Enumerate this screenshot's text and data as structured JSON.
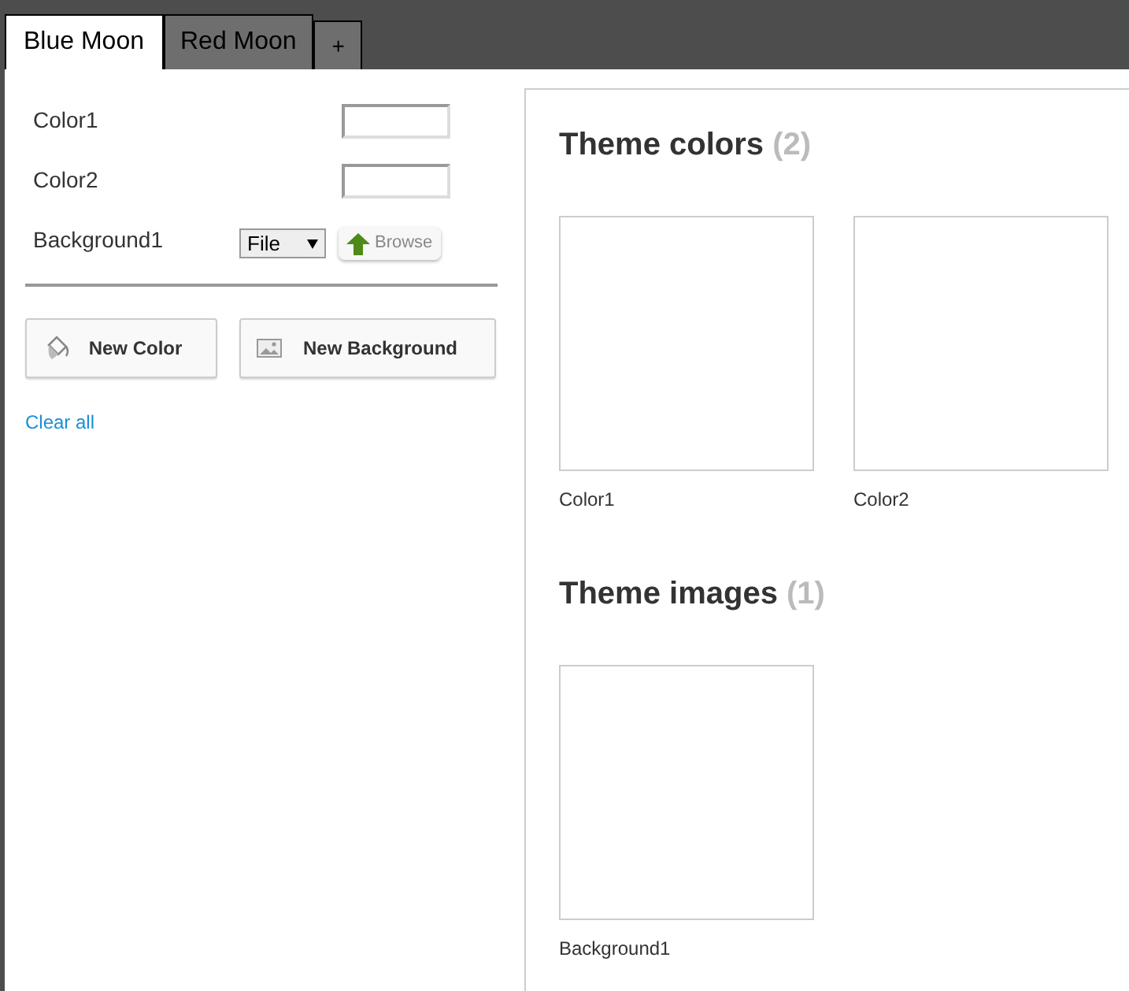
{
  "tabs": [
    {
      "label": "Blue Moon",
      "selected": true
    },
    {
      "label": "Red Moon",
      "selected": false
    }
  ],
  "add_tab": "+",
  "fields": [
    {
      "kind": "color",
      "label": "Color1"
    },
    {
      "kind": "color",
      "label": "Color2"
    },
    {
      "kind": "file",
      "label": "Background1",
      "select": "File",
      "button": "Browse"
    }
  ],
  "actions": [
    {
      "kind": "color",
      "label": "New Color"
    },
    {
      "kind": "background",
      "label": "New Background"
    }
  ],
  "clear_link": "Clear all",
  "sections": [
    {
      "title": "Theme colors",
      "count": "(2)",
      "items": [
        "Color1",
        "Color2"
      ]
    },
    {
      "title": "Theme images",
      "count": "(1)",
      "items": [
        "Background1"
      ]
    }
  ]
}
